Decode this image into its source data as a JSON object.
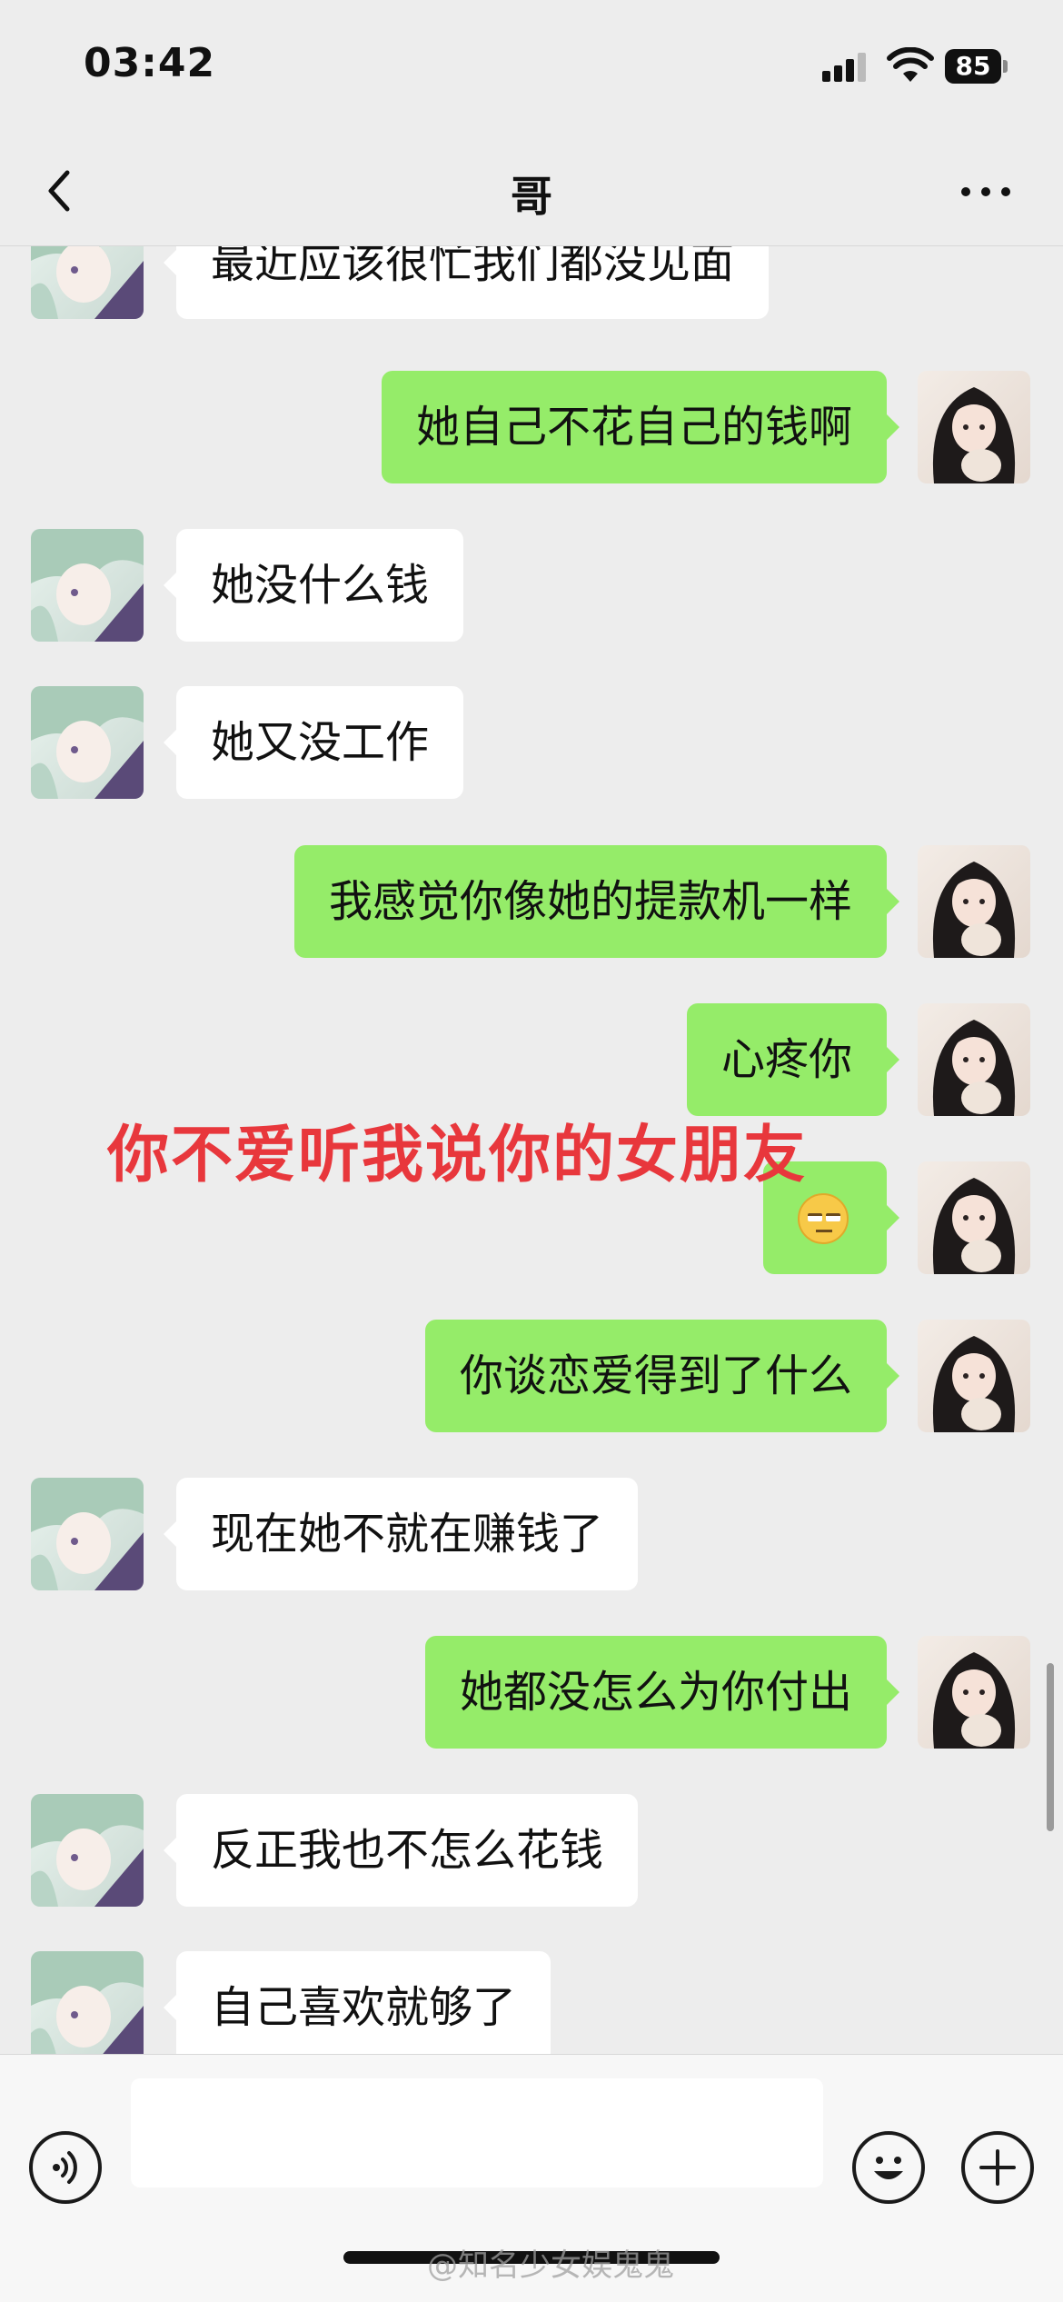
{
  "status_bar": {
    "time": "03:42",
    "battery": "85"
  },
  "nav": {
    "title": "哥"
  },
  "messages": [
    {
      "side": "left",
      "text": "最近应该很忙我们都没见面"
    },
    {
      "side": "right",
      "text": "她自己不花自己的钱啊"
    },
    {
      "side": "left",
      "text": "她没什么钱"
    },
    {
      "side": "left",
      "text": "她又没工作"
    },
    {
      "side": "right",
      "text": "我感觉你像她的提款机一样"
    },
    {
      "side": "right",
      "text": "心疼你"
    },
    {
      "side": "right",
      "emoji": "rolling-eyes-face"
    },
    {
      "side": "right",
      "text": "你谈恋爱得到了什么"
    },
    {
      "side": "left",
      "text": "现在她不就在赚钱了"
    },
    {
      "side": "right",
      "text": "她都没怎么为你付出"
    },
    {
      "side": "left",
      "text": "反正我也不怎么花钱"
    },
    {
      "side": "left",
      "text": "自己喜欢就够了"
    }
  ],
  "overlay_caption": "你不爱听我说你的女朋友",
  "watermark": "@知名少女娱鬼鬼",
  "colors": {
    "background": "#ededed",
    "sent_bubble": "#95ec69",
    "received_bubble": "#ffffff",
    "caption": "#e8373c"
  },
  "icons": [
    "back-chevron-icon",
    "more-dots-icon",
    "voice-icon",
    "emoji-icon",
    "plus-icon",
    "signal-icon",
    "wifi-icon",
    "battery-icon"
  ]
}
